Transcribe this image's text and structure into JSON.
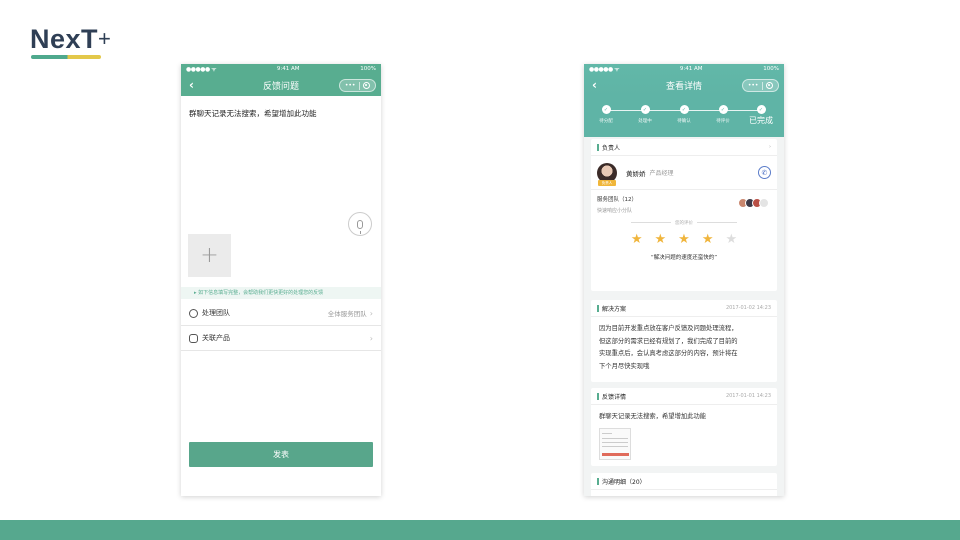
{
  "logo": {
    "text": "NexT",
    "plus": "+"
  },
  "left_phone": {
    "status": {
      "carrier": "●●●●● ᯤ",
      "time": "9:41 AM",
      "battery": "100%"
    },
    "nav": {
      "back": "‹",
      "title": "反馈问题",
      "capsule_dots": "•••"
    },
    "feedback_text": "群聊天记录无法搜索，希望增加此功能",
    "add_symbol": "+",
    "tip": "▸ 如下信息填写完整，会帮助我们更快更好的处理您的反馈",
    "rows": [
      {
        "label": "处理团队",
        "value": "全体服务团队",
        "icon": "team-icon"
      },
      {
        "label": "关联产品",
        "value": "",
        "icon": "product-icon"
      }
    ],
    "chevron": "›",
    "publish_label": "发表"
  },
  "right_phone": {
    "status": {
      "carrier": "●●●●● ᯤ",
      "time": "9:41 AM",
      "battery": "100%"
    },
    "nav": {
      "back": "‹",
      "title": "查看详情",
      "capsule_dots": "•••"
    },
    "steps": [
      {
        "label": "待分配",
        "check": "✓"
      },
      {
        "label": "处理中",
        "check": "✓"
      },
      {
        "label": "待确认",
        "check": "✓"
      },
      {
        "label": "待评价",
        "check": "✓"
      },
      {
        "label": "已完成",
        "check": "✓"
      }
    ],
    "owner_card": {
      "title": "负责人",
      "chevron": "›",
      "avatar_tag": "负责人",
      "name": "黄娇娇",
      "role": "产品经理",
      "phone_icon": "✆",
      "team_title": "服务团队（12）",
      "team_sub": "快速响应小分队",
      "rating_label": "您的评价",
      "stars": [
        "★",
        "★",
        "★",
        "★",
        "★"
      ],
      "stars_filled": 4,
      "quote": "“解决问题的速度还蛮快的”"
    },
    "solution_card": {
      "title": "解决方案",
      "time": "2017-01-02 14:23",
      "lines": [
        "因为目前开发重点放在客户反馈及问题处理流程，",
        "但这部分的需求已经有规划了，我们完成了目前的",
        "实现重点后，会认真考虑这部分的内容，预计将在",
        "下个月尽快实现哦"
      ]
    },
    "detail_card": {
      "title": "反馈详情",
      "time": "2017-01-01 14:23",
      "text": "群聊天记录无法搜索，希望增加此功能"
    },
    "comm_card": {
      "title": "沟通明细（20）"
    }
  },
  "colors": {
    "accent": "#58ad90",
    "teal": "#5fb4a6",
    "star": "#f0b53c",
    "band": "#56a88e"
  }
}
